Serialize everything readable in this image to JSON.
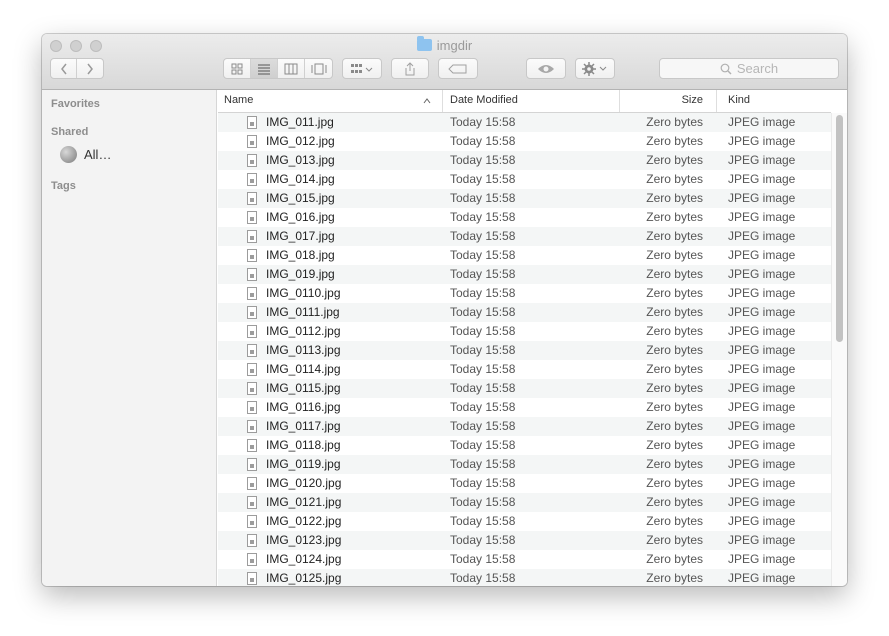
{
  "window": {
    "title": "imgdir"
  },
  "toolbar": {
    "search_placeholder": "Search"
  },
  "sidebar": {
    "favorites_heading": "Favorites",
    "shared_heading": "Shared",
    "shared_item": "All…",
    "tags_heading": "Tags"
  },
  "columns": {
    "name": "Name",
    "date": "Date Modified",
    "size": "Size",
    "kind": "Kind"
  },
  "files": [
    {
      "name": "IMG_011.jpg",
      "date": "Today 15:58",
      "size": "Zero bytes",
      "kind": "JPEG image"
    },
    {
      "name": "IMG_012.jpg",
      "date": "Today 15:58",
      "size": "Zero bytes",
      "kind": "JPEG image"
    },
    {
      "name": "IMG_013.jpg",
      "date": "Today 15:58",
      "size": "Zero bytes",
      "kind": "JPEG image"
    },
    {
      "name": "IMG_014.jpg",
      "date": "Today 15:58",
      "size": "Zero bytes",
      "kind": "JPEG image"
    },
    {
      "name": "IMG_015.jpg",
      "date": "Today 15:58",
      "size": "Zero bytes",
      "kind": "JPEG image"
    },
    {
      "name": "IMG_016.jpg",
      "date": "Today 15:58",
      "size": "Zero bytes",
      "kind": "JPEG image"
    },
    {
      "name": "IMG_017.jpg",
      "date": "Today 15:58",
      "size": "Zero bytes",
      "kind": "JPEG image"
    },
    {
      "name": "IMG_018.jpg",
      "date": "Today 15:58",
      "size": "Zero bytes",
      "kind": "JPEG image"
    },
    {
      "name": "IMG_019.jpg",
      "date": "Today 15:58",
      "size": "Zero bytes",
      "kind": "JPEG image"
    },
    {
      "name": "IMG_0110.jpg",
      "date": "Today 15:58",
      "size": "Zero bytes",
      "kind": "JPEG image"
    },
    {
      "name": "IMG_0111.jpg",
      "date": "Today 15:58",
      "size": "Zero bytes",
      "kind": "JPEG image"
    },
    {
      "name": "IMG_0112.jpg",
      "date": "Today 15:58",
      "size": "Zero bytes",
      "kind": "JPEG image"
    },
    {
      "name": "IMG_0113.jpg",
      "date": "Today 15:58",
      "size": "Zero bytes",
      "kind": "JPEG image"
    },
    {
      "name": "IMG_0114.jpg",
      "date": "Today 15:58",
      "size": "Zero bytes",
      "kind": "JPEG image"
    },
    {
      "name": "IMG_0115.jpg",
      "date": "Today 15:58",
      "size": "Zero bytes",
      "kind": "JPEG image"
    },
    {
      "name": "IMG_0116.jpg",
      "date": "Today 15:58",
      "size": "Zero bytes",
      "kind": "JPEG image"
    },
    {
      "name": "IMG_0117.jpg",
      "date": "Today 15:58",
      "size": "Zero bytes",
      "kind": "JPEG image"
    },
    {
      "name": "IMG_0118.jpg",
      "date": "Today 15:58",
      "size": "Zero bytes",
      "kind": "JPEG image"
    },
    {
      "name": "IMG_0119.jpg",
      "date": "Today 15:58",
      "size": "Zero bytes",
      "kind": "JPEG image"
    },
    {
      "name": "IMG_0120.jpg",
      "date": "Today 15:58",
      "size": "Zero bytes",
      "kind": "JPEG image"
    },
    {
      "name": "IMG_0121.jpg",
      "date": "Today 15:58",
      "size": "Zero bytes",
      "kind": "JPEG image"
    },
    {
      "name": "IMG_0122.jpg",
      "date": "Today 15:58",
      "size": "Zero bytes",
      "kind": "JPEG image"
    },
    {
      "name": "IMG_0123.jpg",
      "date": "Today 15:58",
      "size": "Zero bytes",
      "kind": "JPEG image"
    },
    {
      "name": "IMG_0124.jpg",
      "date": "Today 15:58",
      "size": "Zero bytes",
      "kind": "JPEG image"
    },
    {
      "name": "IMG_0125.jpg",
      "date": "Today 15:58",
      "size": "Zero bytes",
      "kind": "JPEG image"
    }
  ]
}
